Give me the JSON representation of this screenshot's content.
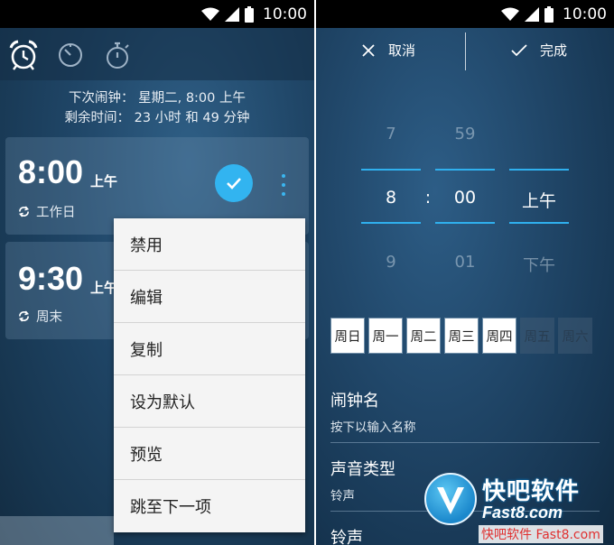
{
  "status_bar": {
    "time": "10:00"
  },
  "left": {
    "tabs": [
      {
        "icon": "alarm-clock-icon",
        "active": true
      },
      {
        "icon": "timer-icon",
        "active": false
      },
      {
        "icon": "stopwatch-icon",
        "active": false
      }
    ],
    "next_alarm": "下次闹钟：  星期二, 8:00 上午",
    "remaining": "剩余时间：  23 小时 和 49 分钟",
    "alarms": [
      {
        "time": "8:00",
        "ampm": "上午",
        "repeat": "工作日",
        "enabled": true
      },
      {
        "time": "9:30",
        "ampm": "上午",
        "repeat": "周末",
        "enabled": false
      }
    ],
    "context_menu": [
      "禁用",
      "编辑",
      "复制",
      "设为默认",
      "预览",
      "跳至下一项"
    ],
    "accent_color": "#32b4f0"
  },
  "right": {
    "cancel_label": "取消",
    "done_label": "完成",
    "picker": {
      "hour": {
        "prev": "7",
        "current": "8",
        "next": "9"
      },
      "separator": ":",
      "minute": {
        "prev": "59",
        "current": "00",
        "next": "01"
      },
      "ampm": {
        "current": "上午",
        "next": "下午"
      }
    },
    "days": [
      {
        "label": "周日",
        "on": true
      },
      {
        "label": "周一",
        "on": true
      },
      {
        "label": "周二",
        "on": true
      },
      {
        "label": "周三",
        "on": true
      },
      {
        "label": "周四",
        "on": true
      },
      {
        "label": "周五",
        "on": false
      },
      {
        "label": "周六",
        "on": false
      }
    ],
    "settings": [
      {
        "title": "闹钟名",
        "subtitle": "按下以输入名称"
      },
      {
        "title": "声音类型",
        "subtitle": "铃声"
      },
      {
        "title": "铃声",
        "subtitle": ""
      }
    ]
  },
  "watermark": {
    "title": "快吧软件",
    "url": "Fast8.com",
    "footer": "快吧软件 Fast8.com"
  }
}
